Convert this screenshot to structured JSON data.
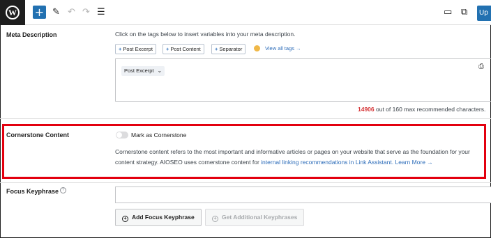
{
  "toolbar": {
    "logo_letter": "W",
    "add_label": "+",
    "update_label": "Up"
  },
  "meta_description": {
    "label": "Meta Description",
    "help": "Click on the tags below to insert variables into your meta description.",
    "tags": [
      "Post Excerpt",
      "Post Content",
      "Separator"
    ],
    "view_all_tags": "View all tags →",
    "chip_label": "Post Excerpt",
    "char_count_num": "14906",
    "char_count_rest": " out of 160 max recommended characters."
  },
  "cornerstone": {
    "label": "Cornerstone Content",
    "toggle_label": "Mark as Cornerstone",
    "toggle_on": false,
    "desc_text": "Cornerstone content refers to the most important and informative articles or pages on your website that serve as the foundation for your content strategy. AIOSEO uses cornerstone content for ",
    "desc_link": "internal linking recommendations in Link Assistant.",
    "learn_more": "Learn More →"
  },
  "focus_keyphrase": {
    "label": "Focus Keyphrase",
    "help_icon": "?",
    "input_value": "",
    "add_button": "Add Focus Keyphrase",
    "additional_button": "Get Additional Keyphrases"
  },
  "colors": {
    "accent": "#2271b1",
    "link": "#2c6cb9",
    "highlight": "#e3000f",
    "count_over": "#d63638"
  }
}
